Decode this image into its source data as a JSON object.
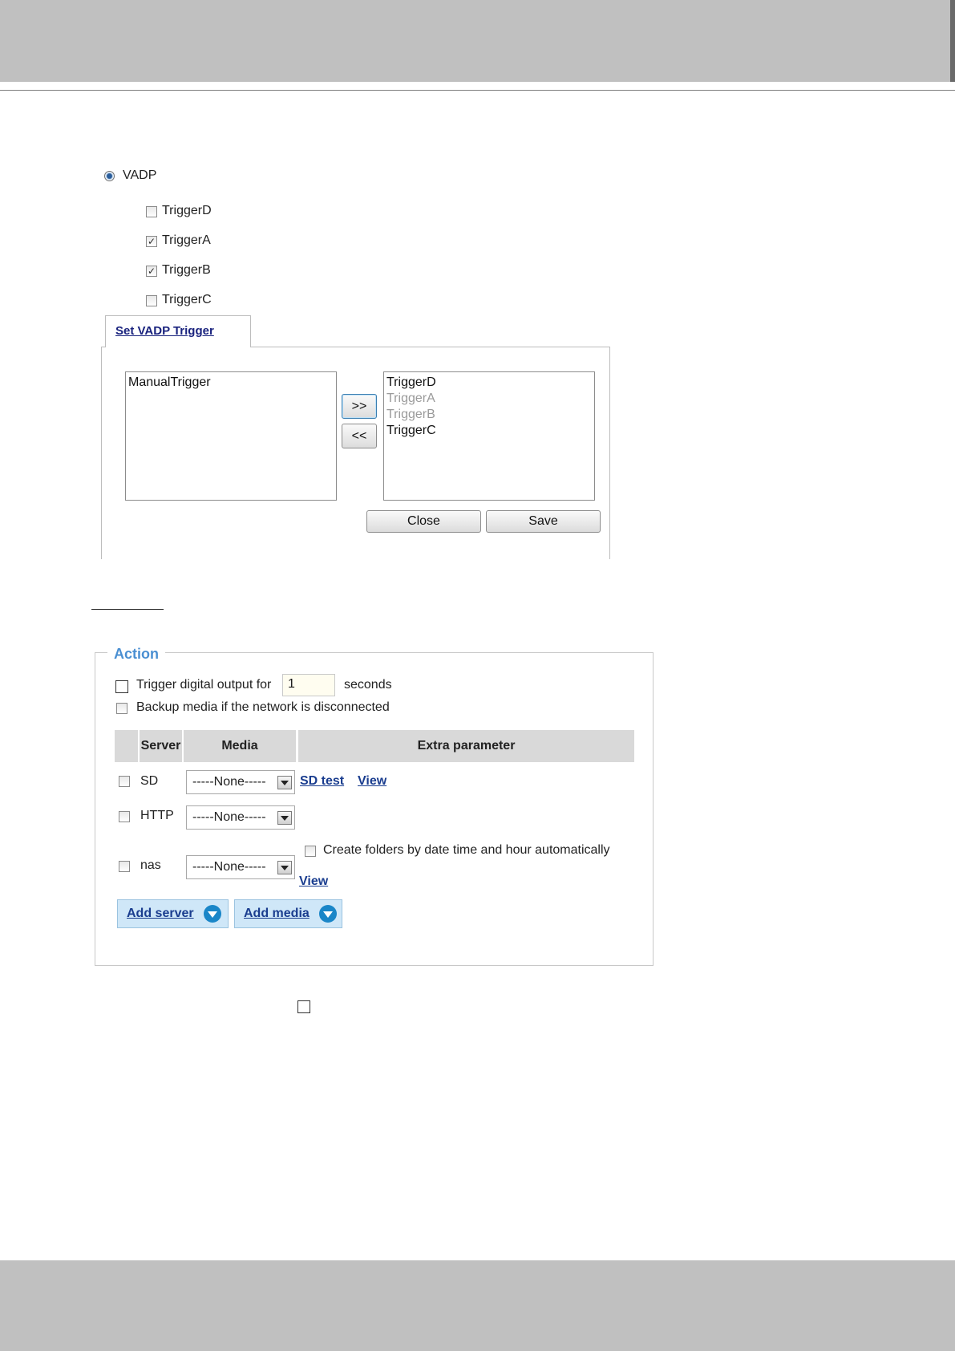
{
  "vadp": {
    "radio_label": "VADP",
    "triggers": [
      {
        "label": "TriggerD",
        "checked": false
      },
      {
        "label": "TriggerA",
        "checked": true
      },
      {
        "label": "TriggerB",
        "checked": true
      },
      {
        "label": "TriggerC",
        "checked": false
      }
    ]
  },
  "trigger_dialog": {
    "tab_label": "Set VADP Trigger",
    "left_list": [
      "ManualTrigger"
    ],
    "right_list": [
      {
        "label": "TriggerD",
        "dimmed": false
      },
      {
        "label": "TriggerA",
        "dimmed": true
      },
      {
        "label": "TriggerB",
        "dimmed": true
      },
      {
        "label": "TriggerC",
        "dimmed": false
      }
    ],
    "move_right_label": ">>",
    "move_left_label": "<<",
    "close_label": "Close",
    "save_label": "Save"
  },
  "action": {
    "legend": "Action",
    "digital_output_label": "Trigger digital output for",
    "digital_output_value": "1",
    "digital_output_unit": "seconds",
    "backup_label": "Backup media if the network is disconnected",
    "table_headers": {
      "server": "Server",
      "media": "Media",
      "extra": "Extra parameter"
    },
    "rows": [
      {
        "server": "SD",
        "media": "-----None-----",
        "link1": "SD test",
        "link2": "View"
      },
      {
        "server": "HTTP",
        "media": "-----None-----"
      },
      {
        "server": "nas",
        "media": "-----None-----",
        "folders_label": "Create folders by date time and hour automatically",
        "link": "View"
      }
    ],
    "add_server_label": "Add server",
    "add_media_label": "Add media"
  },
  "colors": {
    "bars": "#c0c0c0",
    "legend": "#4a8fd2",
    "link": "#1a3d8f",
    "add_button_bg": "#cfe7f8"
  }
}
